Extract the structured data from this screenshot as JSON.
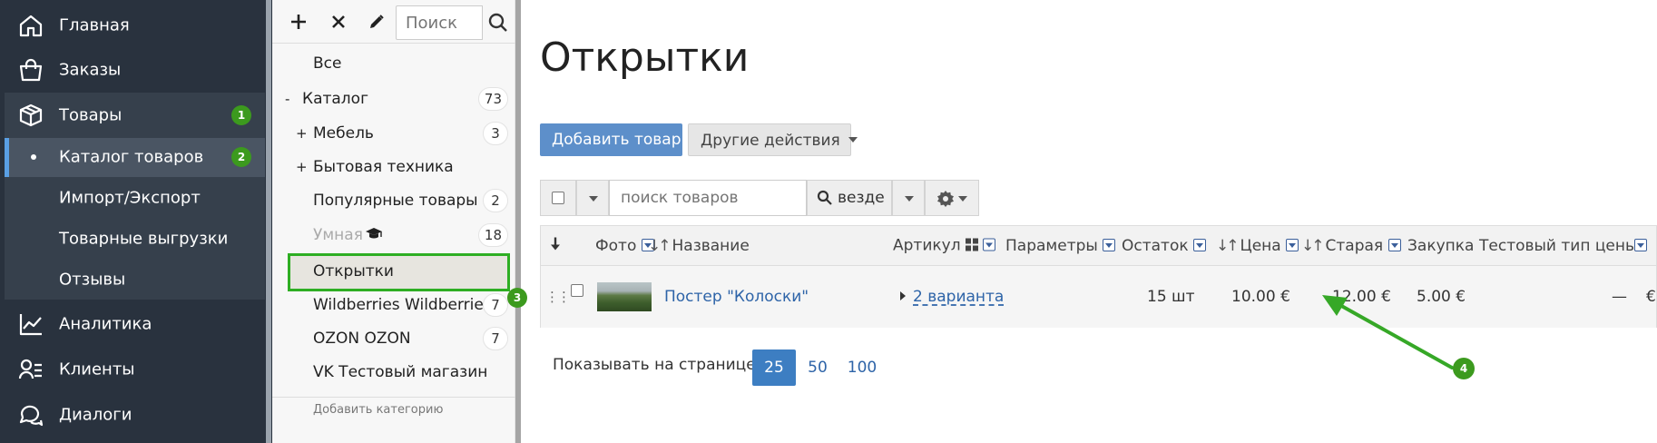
{
  "nav": {
    "items": [
      {
        "label": "Главная",
        "icon": "home-icon"
      },
      {
        "label": "Заказы",
        "icon": "shopping-bag-icon"
      },
      {
        "label": "Товары",
        "icon": "box-icon",
        "badge": "1"
      },
      {
        "label": "Аналитика",
        "icon": "chart-line-icon"
      },
      {
        "label": "Клиенты",
        "icon": "users-list-icon"
      },
      {
        "label": "Диалоги",
        "icon": "chat-bubbles-icon"
      }
    ],
    "sub_items": [
      {
        "label": "Каталог товаров",
        "badge": "2"
      },
      {
        "label": "Импорт/Экспорт"
      },
      {
        "label": "Товарные выгрузки"
      },
      {
        "label": "Отзывы"
      }
    ]
  },
  "categories": {
    "search_placeholder": "Поиск",
    "rows": [
      {
        "label": "Все",
        "prefix": "",
        "count": ""
      },
      {
        "label": "Каталог",
        "prefix": "-",
        "count": "73"
      },
      {
        "label": "Мебель",
        "prefix": "+",
        "count": "3"
      },
      {
        "label": "Бытовая техника",
        "prefix": "+",
        "count": ""
      },
      {
        "label": "Популярные товары",
        "prefix": "",
        "count": "2"
      },
      {
        "label": "Умная",
        "prefix": "",
        "count": "18"
      },
      {
        "label": "Открытки",
        "prefix": "",
        "count": ""
      },
      {
        "label": "Wildberries Wildberries",
        "prefix": "",
        "count": "7"
      },
      {
        "label": "OZON OZON",
        "prefix": "",
        "count": "7"
      },
      {
        "label": "VK Тестовый магазин",
        "prefix": "",
        "count": ""
      }
    ],
    "selected_badge": "3",
    "add_label": "Добавить категорию"
  },
  "main": {
    "title": "Открытки",
    "add_button": "Добавить товар",
    "other_actions": "Другие действия",
    "search_placeholder": "поиск товаров",
    "search_scope": "везде",
    "columns": {
      "photo": "Фото",
      "name": "Название",
      "sku": "Артикул",
      "params": "Параметры",
      "stock": "Остаток",
      "price": "Цена",
      "old_price": "Старая",
      "purchase": "Закупка",
      "test_price": "Тестовый тип цены"
    },
    "row": {
      "name": "Постер \"Колоски\"",
      "variants": "2 варианта",
      "stock": "15 шт",
      "price": "10.00 €",
      "old_price": "12.00 €",
      "purchase": "5.00 €",
      "test_price": "—",
      "currency": "€"
    },
    "pager": {
      "label": "Показывать на странице:",
      "options": [
        "25",
        "50",
        "100"
      ],
      "active": "25"
    },
    "annotation_badge": "4"
  },
  "colors": {
    "nav_bg": "#29323e",
    "accent_green": "#3c9a1e",
    "primary_blue": "#5d8fca",
    "link": "#2e64a8"
  }
}
